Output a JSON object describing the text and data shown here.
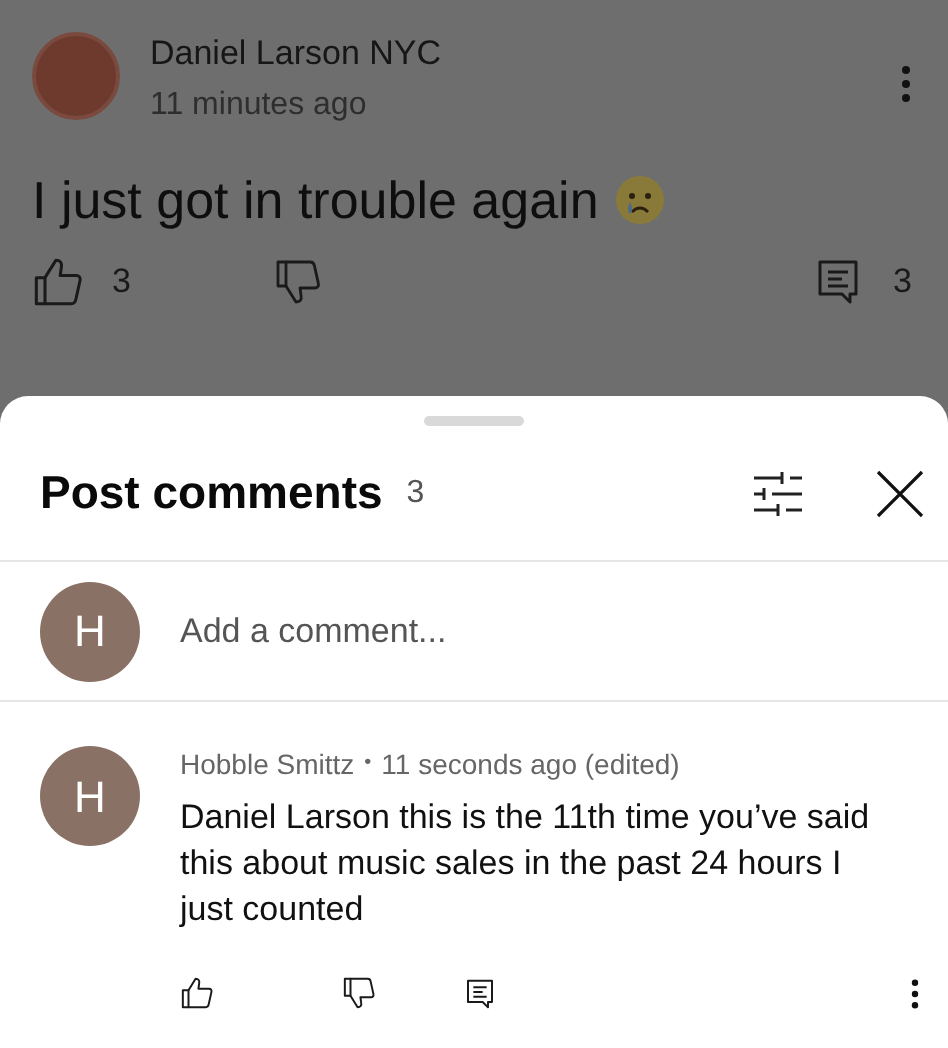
{
  "post": {
    "author": "Daniel Larson NYC",
    "time": "11 minutes ago",
    "text": "I just got in trouble again",
    "likes": "3",
    "comments": "3"
  },
  "sheet": {
    "title": "Post comments",
    "count": "3",
    "input": {
      "avatar_letter": "H",
      "placeholder": "Add a comment..."
    }
  },
  "comments": [
    {
      "avatar_letter": "H",
      "author": "Hobble Smittz",
      "separator": "•",
      "time": "11 seconds ago (edited)",
      "text": "Daniel Larson this is the 11th time you’ve said this about music sales in the past 24 hours I just counted"
    }
  ]
}
